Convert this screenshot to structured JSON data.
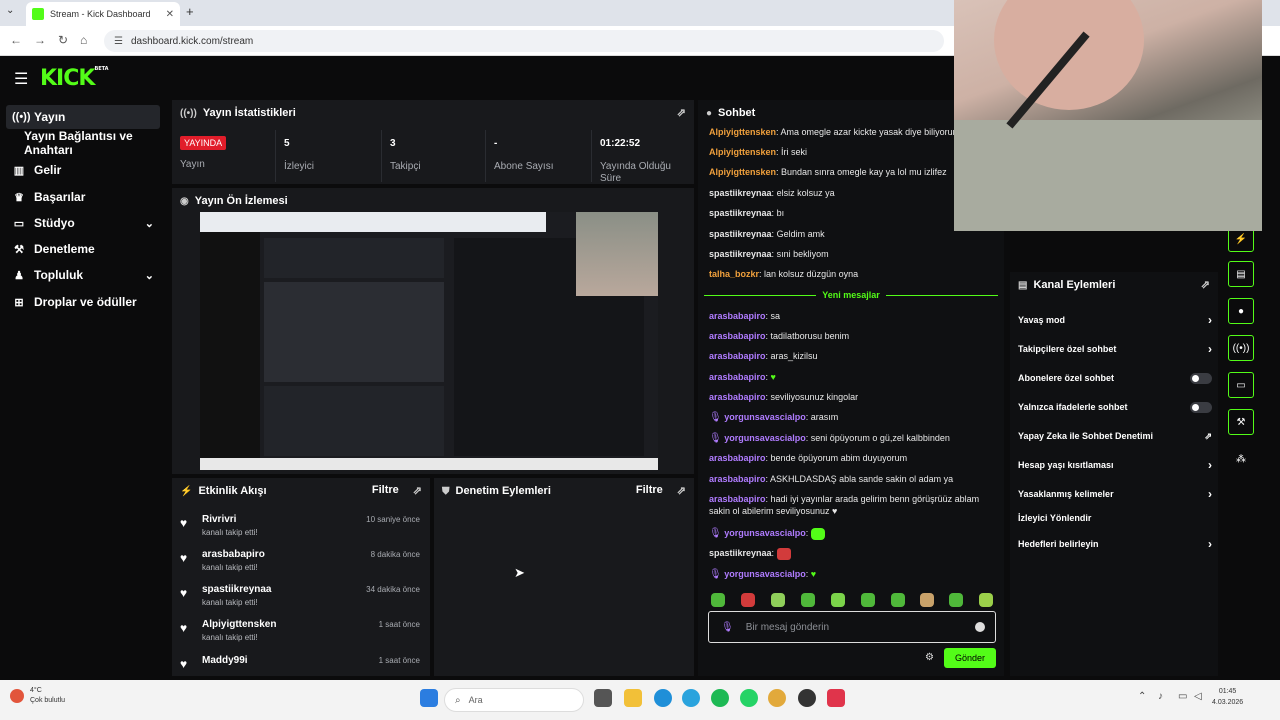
{
  "browser": {
    "tab_title": "Stream - Kick Dashboard",
    "url": "dashboard.kick.com/stream"
  },
  "app": {
    "logo": "KICK",
    "logo_sup": "BETA"
  },
  "sidebar": {
    "items": [
      {
        "label": "Yayın",
        "icon": "broadcast-icon"
      },
      {
        "label": "Yayın Bağlantısı ve Anahtarı",
        "icon": ""
      },
      {
        "label": "Gelir",
        "icon": "chart-icon"
      },
      {
        "label": "Başarılar",
        "icon": "trophy-icon"
      },
      {
        "label": "Stüdyo",
        "icon": "studio-icon"
      },
      {
        "label": "Denetleme",
        "icon": "wrench-icon"
      },
      {
        "label": "Topluluk",
        "icon": "community-icon"
      },
      {
        "label": "Droplar ve ödüller",
        "icon": "gift-icon"
      }
    ]
  },
  "stats": {
    "title": "Yayın İstatistikleri",
    "live_badge": "YAYINDA",
    "cells": [
      {
        "value": "",
        "label": "Yayın"
      },
      {
        "value": "5",
        "label": "İzleyici"
      },
      {
        "value": "3",
        "label": "Takipçi"
      },
      {
        "value": "-",
        "label": "Abone Sayısı"
      },
      {
        "value": "01:22:52",
        "label": "Yayında Olduğu Süre"
      }
    ]
  },
  "preview": {
    "title": "Yayın Ön İzlemesi"
  },
  "activity": {
    "title": "Etkinlik Akışı",
    "filter": "Filtre",
    "items": [
      {
        "name": "Rivrivri",
        "sub": "kanalı takip etti!",
        "time": "10 saniye önce"
      },
      {
        "name": "arasbabapiro",
        "sub": "kanalı takip etti!",
        "time": "8 dakika önce"
      },
      {
        "name": "spastiikreynaa",
        "sub": "kanalı takip etti!",
        "time": "34 dakika önce"
      },
      {
        "name": "Alpiyigttensken",
        "sub": "kanalı takip etti!",
        "time": "1 saat önce"
      },
      {
        "name": "Maddy99i",
        "sub": "",
        "time": "1 saat önce"
      }
    ]
  },
  "moderation": {
    "title": "Denetim Eylemleri",
    "filter": "Filtre"
  },
  "chat": {
    "title": "Sohbet",
    "new_messages": "Yeni mesajlar",
    "placeholder": "Bir mesaj gönderin",
    "send": "Gönder",
    "messages_top": [
      {
        "user": "Alpiyigttensken",
        "text": "Ama omegle azar kickte yasak diye biliyorum",
        "color": "orange"
      },
      {
        "user": "Alpiyigttensken",
        "text": "İri seki",
        "color": "orange"
      },
      {
        "user": "Alpiyigttensken",
        "text": "Bundan sınra omegle kay ya lol mu izlifez",
        "color": "orange"
      },
      {
        "user": "spastiikreynaa",
        "text": "elsiz kolsuz ya",
        "color": "grey"
      },
      {
        "user": "spastiikreynaa",
        "text": "bı",
        "color": "grey"
      },
      {
        "user": "spastiikreynaa",
        "text": "Geldim amk",
        "color": "grey"
      },
      {
        "user": "spastiikreynaa",
        "text": "sıni bekliyom",
        "color": "grey"
      },
      {
        "user": "talha_bozkr",
        "text": "lan kolsuz düzgün oyna",
        "color": "orange"
      }
    ],
    "messages_new": [
      {
        "user": "arasbabapiro",
        "text": "sa",
        "color": "purple"
      },
      {
        "user": "arasbabapiro",
        "text": "tadilatborusu benim",
        "color": "purple"
      },
      {
        "user": "arasbabapiro",
        "text": "aras_kizilsu",
        "color": "purple"
      },
      {
        "user": "arasbabapiro",
        "text": "♥",
        "color": "purple"
      },
      {
        "user": "arasbabapiro",
        "text": "seviliyosunuz kingolar",
        "color": "purple"
      },
      {
        "user": "yorgunsavascialpo",
        "text": "arasım",
        "color": "purple",
        "mic": true
      },
      {
        "user": "yorgunsavascialpo",
        "text": "seni öpüyorum o gü,zel kalbbinden",
        "color": "purple",
        "mic": true
      },
      {
        "user": "arasbabapiro",
        "text": "bende öpüyorum abim duyuyorum",
        "color": "purple"
      },
      {
        "user": "arasbabapiro",
        "text": "ASKHLDASDAŞ abla sande sakin ol adam ya",
        "color": "purple"
      },
      {
        "user": "arasbabapiro",
        "text": "hadi iyi yayınlar arada gelirim benn görüşrüüz ablam sakin ol abilerim seviliyosunuz ♥",
        "color": "purple"
      },
      {
        "user": "yorgunsavascialpo",
        "text": "",
        "color": "purple",
        "mic": true
      },
      {
        "user": "spastiikreynaa",
        "text": "",
        "color": "grey"
      },
      {
        "user": "yorgunsavascialpo",
        "text": "♥",
        "color": "purple",
        "mic": true
      }
    ]
  },
  "channel_actions": {
    "title": "Kanal Eylemleri",
    "items": [
      {
        "label": "Yavaş mod",
        "control": "chevron"
      },
      {
        "label": "Takipçilere özel sohbet",
        "control": "chevron"
      },
      {
        "label": "Abonelere özel sohbet",
        "control": "toggle"
      },
      {
        "label": "Yalnızca ifadelerle sohbet",
        "control": "toggle"
      },
      {
        "label": "Yapay Zeka ile Sohbet Denetimi",
        "control": "external"
      },
      {
        "label": "Hesap yaşı kısıtlaması",
        "control": "chevron"
      },
      {
        "label": "Yasaklanmış kelimeler",
        "control": "chevron"
      },
      {
        "label": "İzleyici Yönlendir",
        "control": "none"
      },
      {
        "label": "Hedefleri belirleyin",
        "control": "chevron"
      }
    ]
  },
  "taskbar": {
    "weather_temp": "4°C",
    "weather_desc": "Çok bulutlu",
    "search": "Ara",
    "time": "01:45",
    "date": "4.03.2026"
  }
}
